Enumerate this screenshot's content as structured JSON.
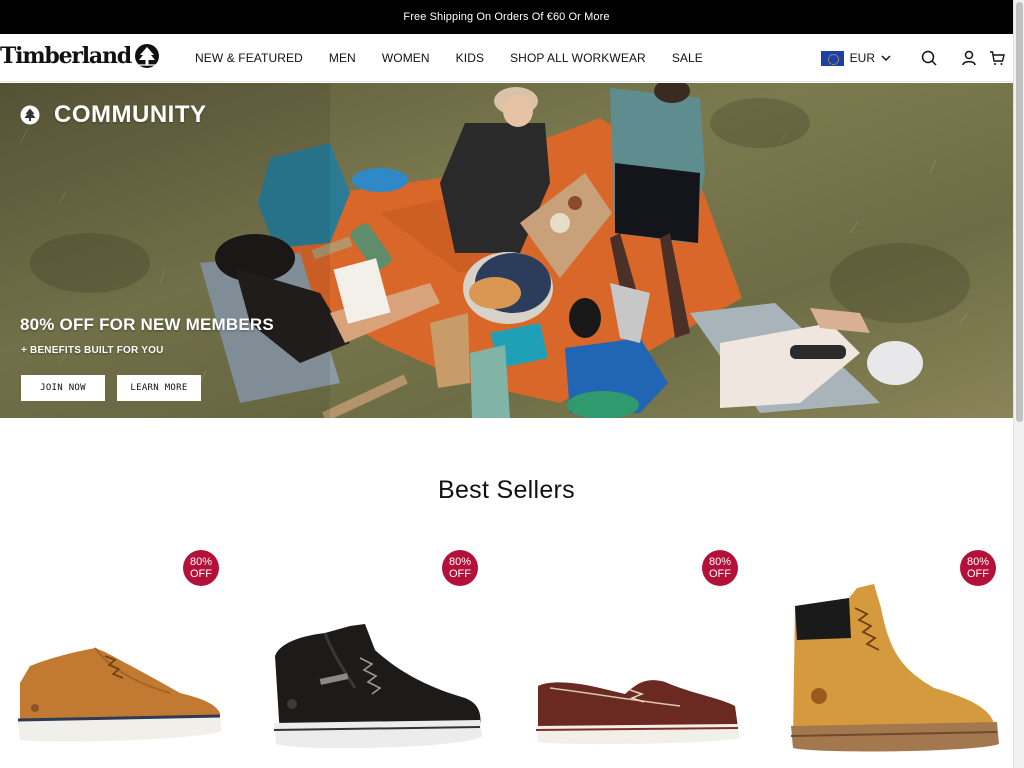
{
  "announcement": "Free Shipping On Orders Of €60 Or More",
  "header": {
    "logo": "Timberland",
    "nav": [
      "NEW & FEATURED",
      "MEN",
      "WOMEN",
      "KIDS",
      "SHOP ALL WORKWEAR",
      "SALE"
    ],
    "currency": "EUR",
    "icons": [
      "search-icon",
      "account-icon",
      "cart-icon"
    ]
  },
  "hero": {
    "tag": "COMMUNITY",
    "headline": "80% OFF FOR NEW MEMBERS",
    "subline": "+ BENEFITS BUILT FOR YOU",
    "buttons": {
      "join": "JOIN NOW",
      "learn": "LEARN MORE"
    }
  },
  "best_sellers": {
    "title": "Best Sellers",
    "products": [
      {
        "badge_value": "80%",
        "badge_label": "OFF",
        "image": "wheat low sneaker"
      },
      {
        "badge_value": "80%",
        "badge_label": "OFF",
        "image": "black hiker boot"
      },
      {
        "badge_value": "80%",
        "badge_label": "OFF",
        "image": "brown boat shoe"
      },
      {
        "badge_value": "80%",
        "badge_label": "OFF",
        "image": "wheat 6-inch boot"
      }
    ]
  },
  "colors": {
    "announcement_bg": "#000000",
    "badge": "#b3113a",
    "flag": "#1d3fa6"
  }
}
